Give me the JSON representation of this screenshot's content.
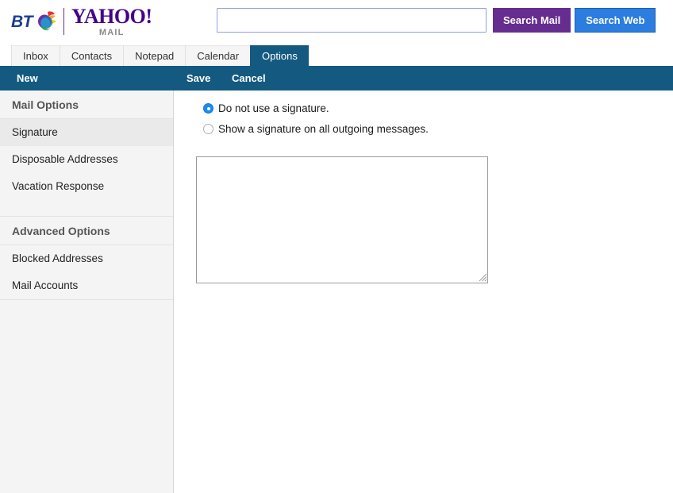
{
  "header": {
    "bt_logo_text": "BT",
    "bt_globe_icon": "bt-globe-icon",
    "yahoo_logo_text": "YAHOO!",
    "yahoo_sub_text": "MAIL",
    "search": {
      "value": "",
      "placeholder": "",
      "search_mail_label": "Search Mail",
      "search_web_label": "Search Web",
      "search_mail_color": "#662d91",
      "search_web_color": "#2b7de0",
      "input_border_color": "#8f9fe8"
    }
  },
  "tabs": [
    {
      "label": "Inbox",
      "active": false
    },
    {
      "label": "Contacts",
      "active": false
    },
    {
      "label": "Notepad",
      "active": false
    },
    {
      "label": "Calendar",
      "active": false
    },
    {
      "label": "Options",
      "active": true
    }
  ],
  "toolbar": {
    "new_label": "New",
    "save_label": "Save",
    "cancel_label": "Cancel",
    "background_color": "#145a80"
  },
  "sidebar": {
    "sections": [
      {
        "title": "Mail Options",
        "items": [
          {
            "label": "Signature",
            "selected": true
          },
          {
            "label": "Disposable Addresses",
            "selected": false
          },
          {
            "label": "Vacation Response",
            "selected": false
          }
        ]
      },
      {
        "title": "Advanced Options",
        "items": [
          {
            "label": "Blocked Addresses",
            "selected": false
          },
          {
            "label": "Mail Accounts",
            "selected": false
          }
        ]
      }
    ]
  },
  "content": {
    "radio_options": [
      {
        "label": "Do not use a signature.",
        "checked": true
      },
      {
        "label": "Show a signature on all outgoing messages.",
        "checked": false
      }
    ],
    "signature_textarea": {
      "value": "",
      "placeholder": ""
    }
  }
}
